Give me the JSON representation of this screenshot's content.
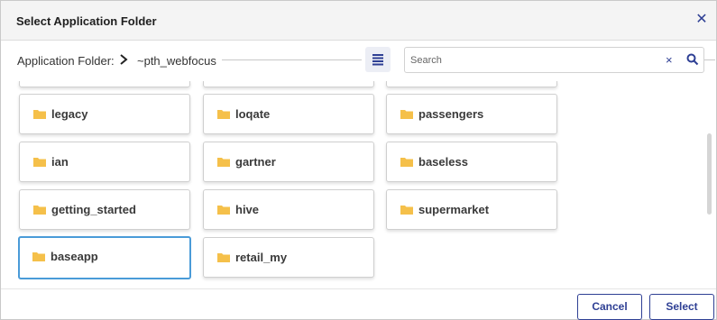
{
  "dialog": {
    "title": "Select Application Folder",
    "close_icon": "close-icon"
  },
  "path": {
    "label": "Application Folder:",
    "value": "~pth_webfocus"
  },
  "search": {
    "placeholder": "Search",
    "value": "",
    "clear_label": "×"
  },
  "folders": [
    {
      "label": "legacy",
      "selected": false
    },
    {
      "label": "loqate",
      "selected": false
    },
    {
      "label": "passengers",
      "selected": false
    },
    {
      "label": "ian",
      "selected": false
    },
    {
      "label": "gartner",
      "selected": false
    },
    {
      "label": "baseless",
      "selected": false
    },
    {
      "label": "getting_started",
      "selected": false
    },
    {
      "label": "hive",
      "selected": false
    },
    {
      "label": "supermarket",
      "selected": false
    },
    {
      "label": "baseapp",
      "selected": true
    },
    {
      "label": "retail_my",
      "selected": false
    }
  ],
  "footer": {
    "cancel_label": "Cancel",
    "select_label": "Select"
  },
  "colors": {
    "accent": "#2e3f94",
    "selected_border": "#4a9bd8",
    "folder": "#f5c04a"
  }
}
